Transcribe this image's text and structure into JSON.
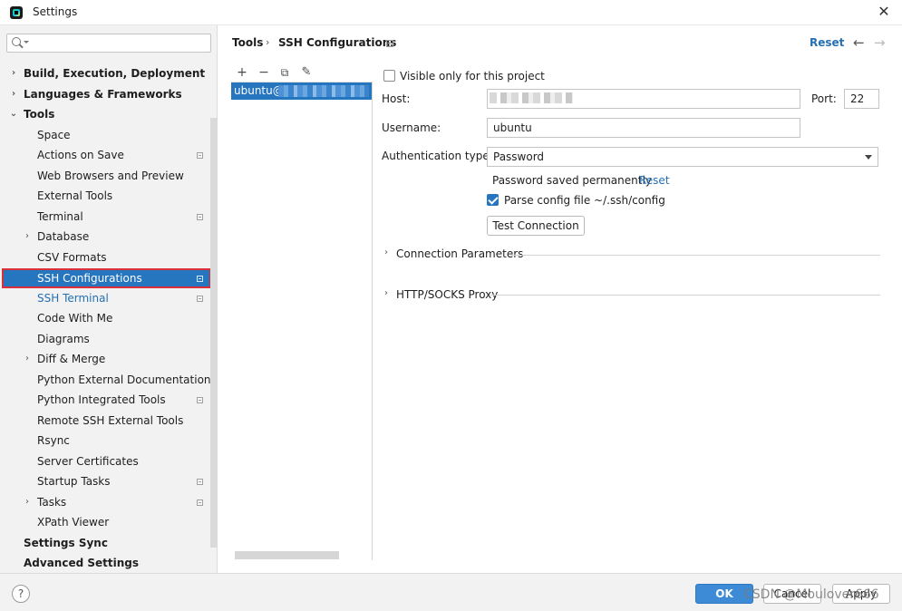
{
  "window": {
    "title": "Settings",
    "close_glyph": "✕"
  },
  "search": {
    "placeholder": "",
    "value": ""
  },
  "sidebar": {
    "items": [
      {
        "label": "Build, Execution, Deployment",
        "arrow": "›"
      },
      {
        "label": "Languages & Frameworks",
        "arrow": "›"
      },
      {
        "label": "Tools",
        "arrow": "⌄"
      },
      {
        "label": "Space"
      },
      {
        "label": "Actions on Save"
      },
      {
        "label": "Web Browsers and Preview"
      },
      {
        "label": "External Tools"
      },
      {
        "label": "Terminal"
      },
      {
        "label": "Database",
        "arrow": "›"
      },
      {
        "label": "CSV Formats"
      },
      {
        "label": "SSH Configurations"
      },
      {
        "label": "SSH Terminal"
      },
      {
        "label": "Code With Me"
      },
      {
        "label": "Diagrams"
      },
      {
        "label": "Diff & Merge",
        "arrow": "›"
      },
      {
        "label": "Python External Documentation"
      },
      {
        "label": "Python Integrated Tools"
      },
      {
        "label": "Remote SSH External Tools"
      },
      {
        "label": "Rsync"
      },
      {
        "label": "Server Certificates"
      },
      {
        "label": "Startup Tasks"
      },
      {
        "label": "Tasks",
        "arrow": "›"
      },
      {
        "label": "XPath Viewer"
      },
      {
        "label": "Settings Sync"
      },
      {
        "label": "Advanced Settings"
      }
    ]
  },
  "header": {
    "crumb_parent": "Tools",
    "crumb_sep": "›",
    "crumb_current": "SSH Configurations",
    "reset": "Reset",
    "back_glyph": "←",
    "forward_glyph": "→"
  },
  "list": {
    "toolbar": {
      "add": "+",
      "remove": "−",
      "copy": "⧉",
      "edit": "✎"
    },
    "entries": [
      {
        "label": "ubuntu@"
      }
    ]
  },
  "form": {
    "visible_only_label": "Visible only for this project",
    "visible_only_checked": false,
    "host_label": "Host:",
    "host_value": "",
    "port_label": "Port:",
    "port_value": "22",
    "username_label": "Username:",
    "username_value": "ubuntu",
    "auth_label": "Authentication type:",
    "auth_value": "Password",
    "password_saved_text": "Password saved permanently",
    "password_reset": "Reset",
    "parse_config_label": "Parse config file ~/.ssh/config",
    "parse_config_checked": true,
    "test_connection": "Test Connection",
    "section_chevron": "›",
    "section_connection": "Connection Parameters",
    "section_proxy": "HTTP/SOCKS Proxy"
  },
  "footer": {
    "help": "?",
    "ok": "OK",
    "cancel": "Cancel",
    "apply": "Apply",
    "watermark": "CSDN @Moulover666"
  }
}
